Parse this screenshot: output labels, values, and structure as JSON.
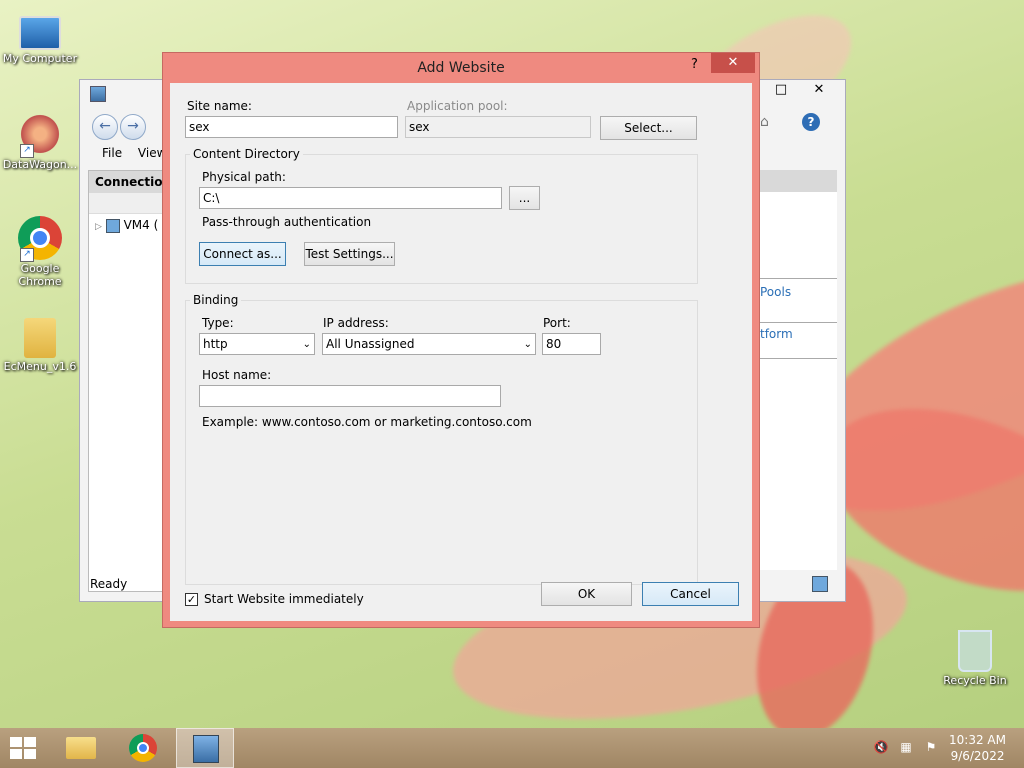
{
  "desktop": {
    "icons": [
      {
        "label": "My Computer"
      },
      {
        "label": "DataWagon..."
      },
      {
        "label": "Google Chrome"
      },
      {
        "label": "EcMenu_v1.6"
      },
      {
        "label": "Recycle Bin"
      }
    ]
  },
  "iis_window": {
    "menu": [
      "File",
      "View"
    ],
    "connections_header": "Connections",
    "tree_item": "VM4 (",
    "right_links": [
      "Pools",
      "tform"
    ],
    "status": "Ready"
  },
  "dialog": {
    "title": "Add Website",
    "help": "?",
    "close": "✕",
    "site_name_label": "Site name:",
    "site_name_value": "sex",
    "app_pool_label": "Application pool:",
    "app_pool_value": "sex",
    "select_button": "Select...",
    "content_dir_title": "Content Directory",
    "physical_path_label": "Physical path:",
    "physical_path_value": "C:\\",
    "browse_button": "...",
    "passthrough_label": "Pass-through authentication",
    "connect_as_button": "Connect as...",
    "test_settings_button": "Test Settings...",
    "binding_title": "Binding",
    "type_label": "Type:",
    "type_value": "http",
    "ip_label": "IP address:",
    "ip_value": "All Unassigned",
    "port_label": "Port:",
    "port_value": "80",
    "host_label": "Host name:",
    "host_value": "",
    "example_text": "Example: www.contoso.com or marketing.contoso.com",
    "start_label": "Start Website immediately",
    "start_checked": "✓",
    "ok_button": "OK",
    "cancel_button": "Cancel"
  },
  "taskbar": {
    "time": "10:32 AM",
    "date": "9/6/2022"
  }
}
